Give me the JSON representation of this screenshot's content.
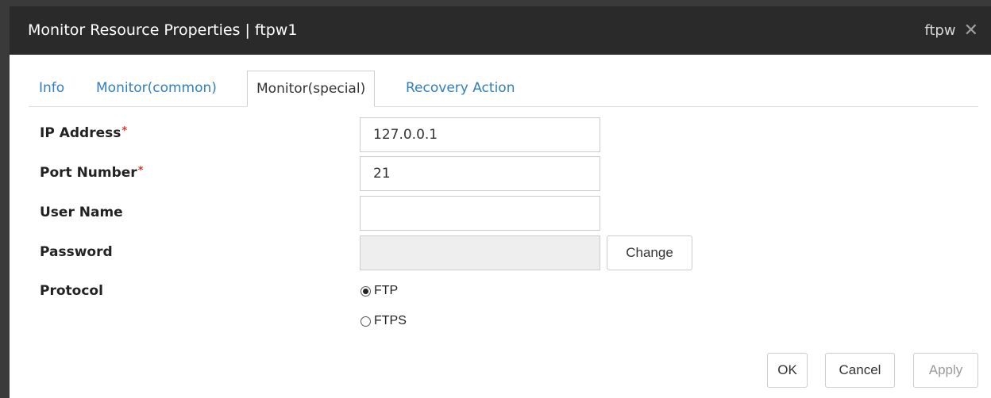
{
  "window": {
    "title": "Monitor Resource Properties | ftpw1",
    "right_label": "ftpw",
    "close_glyph": "✕"
  },
  "tabs": [
    {
      "label": "Info",
      "active": false
    },
    {
      "label": "Monitor(common)",
      "active": false
    },
    {
      "label": "Monitor(special)",
      "active": true
    },
    {
      "label": "Recovery Action",
      "active": false
    }
  ],
  "form": {
    "required_mark": "*",
    "ip_address": {
      "label": "IP Address",
      "value": "127.0.0.1",
      "required": true
    },
    "port_number": {
      "label": "Port Number",
      "value": "21",
      "required": true
    },
    "user_name": {
      "label": "User Name",
      "value": ""
    },
    "password": {
      "label": "Password",
      "value": "",
      "disabled": true,
      "change_label": "Change"
    },
    "protocol": {
      "label": "Protocol",
      "options": [
        {
          "label": "FTP",
          "selected": true
        },
        {
          "label": "FTPS",
          "selected": false
        }
      ]
    }
  },
  "footer": {
    "ok_label": "OK",
    "cancel_label": "Cancel",
    "apply_label": "Apply",
    "apply_disabled": true
  },
  "colors": {
    "titlebar_bg": "#2a2a2a",
    "tab_link": "#2f7fc1",
    "required": "#d9342b"
  }
}
